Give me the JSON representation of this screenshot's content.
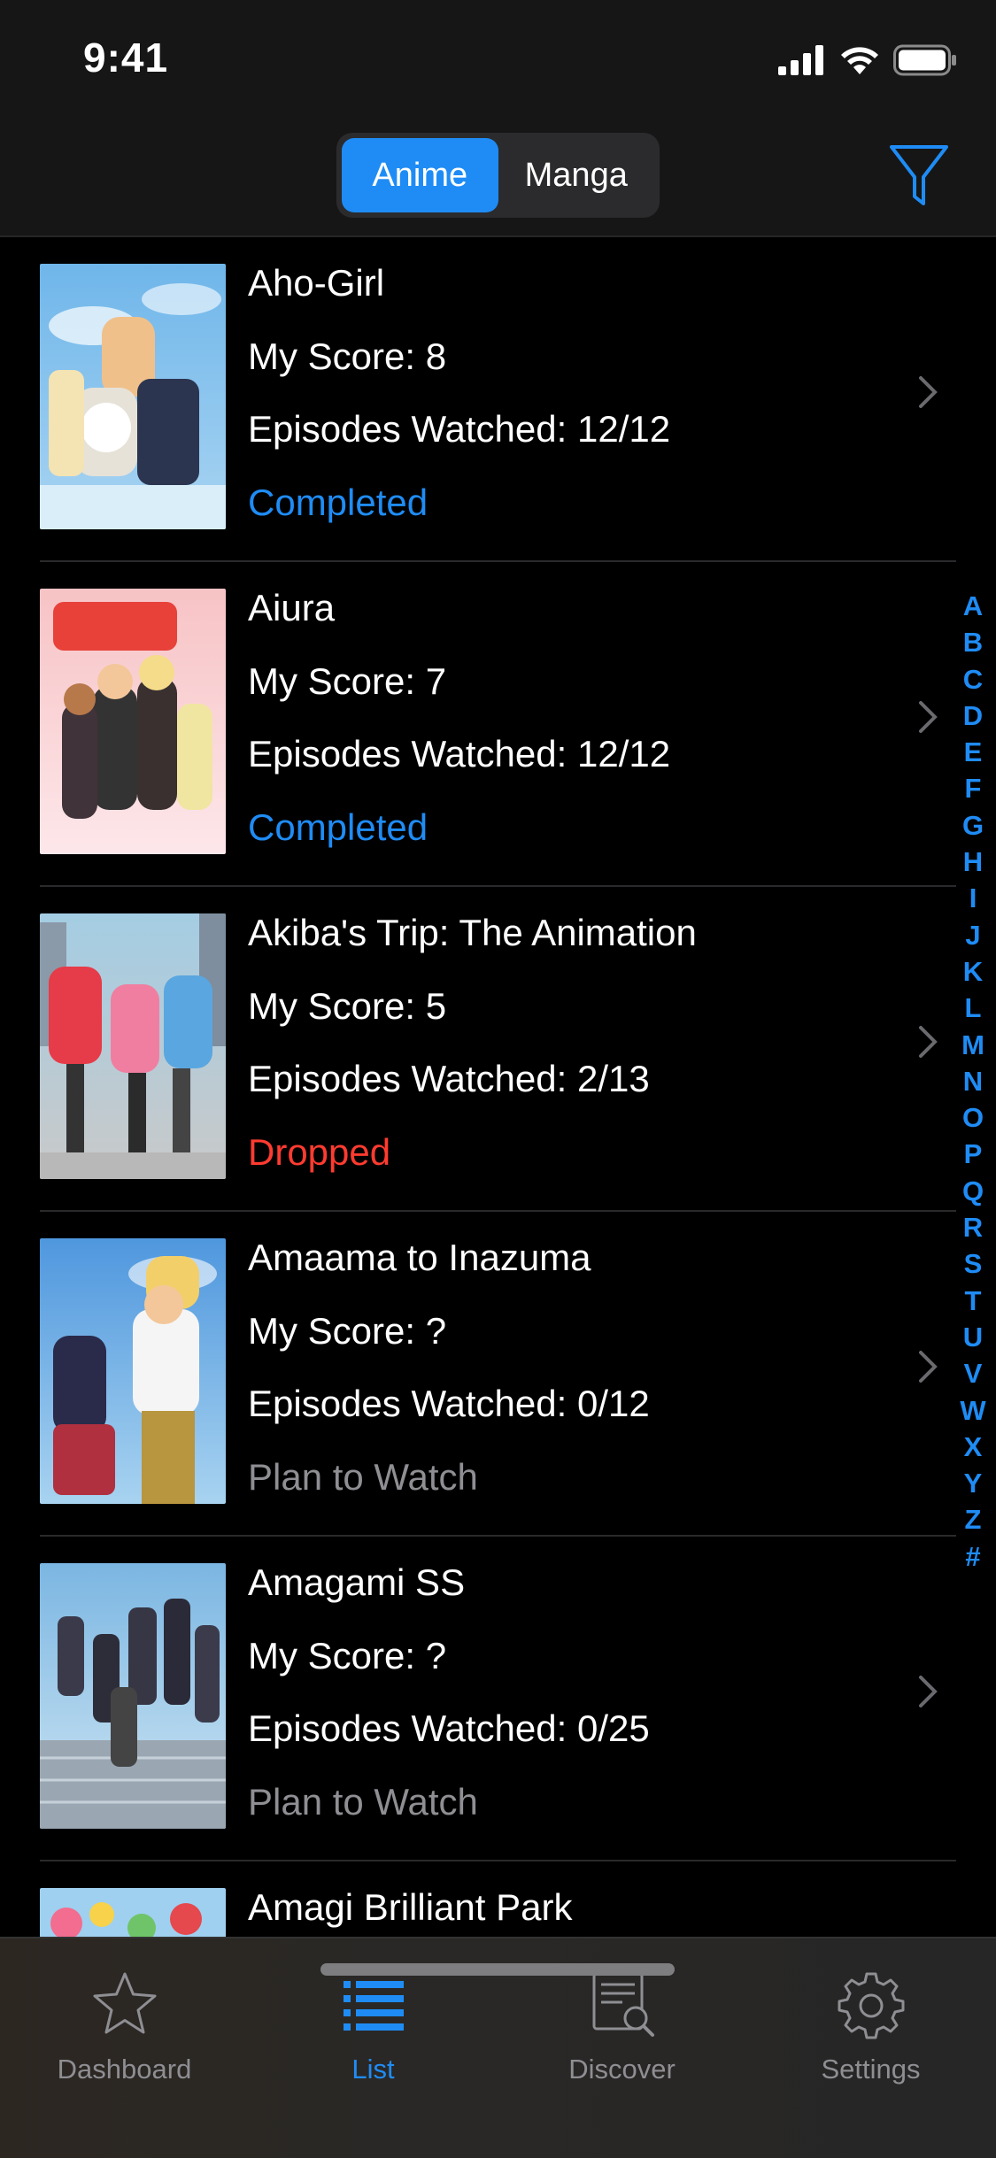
{
  "status_bar": {
    "time": "9:41"
  },
  "segment": {
    "items": [
      "Anime",
      "Manga"
    ],
    "selected": "Anime"
  },
  "colors": {
    "accent": "#1f8cf5",
    "completed": "#1f8cf5",
    "dropped": "#ff3b30",
    "plan": "#8e8e93"
  },
  "list": [
    {
      "title": "Aho-Girl",
      "score": "My Score: 8",
      "episodes": "Episodes Watched: 12/12",
      "status": "Completed",
      "status_kind": "completed"
    },
    {
      "title": "Aiura",
      "score": "My Score: 7",
      "episodes": "Episodes Watched: 12/12",
      "status": "Completed",
      "status_kind": "completed"
    },
    {
      "title": "Akiba's Trip: The Animation",
      "score": "My Score: 5",
      "episodes": "Episodes Watched: 2/13",
      "status": "Dropped",
      "status_kind": "dropped"
    },
    {
      "title": "Amaama to Inazuma",
      "score": "My Score: ?",
      "episodes": "Episodes Watched: 0/12",
      "status": "Plan to Watch",
      "status_kind": "plan"
    },
    {
      "title": "Amagami SS",
      "score": "My Score: ?",
      "episodes": "Episodes Watched: 0/25",
      "status": "Plan to Watch",
      "status_kind": "plan"
    },
    {
      "title": "Amagi Brilliant Park",
      "score": "",
      "episodes": "",
      "status": "",
      "status_kind": "plan"
    }
  ],
  "index_letters": [
    "A",
    "B",
    "C",
    "D",
    "E",
    "F",
    "G",
    "H",
    "I",
    "J",
    "K",
    "L",
    "M",
    "N",
    "O",
    "P",
    "Q",
    "R",
    "S",
    "T",
    "U",
    "V",
    "W",
    "X",
    "Y",
    "Z",
    "#"
  ],
  "tabs": [
    {
      "label": "Dashboard",
      "icon": "star-icon"
    },
    {
      "label": "List",
      "icon": "list-icon"
    },
    {
      "label": "Discover",
      "icon": "discover-icon"
    },
    {
      "label": "Settings",
      "icon": "gear-icon"
    }
  ],
  "active_tab": "List"
}
